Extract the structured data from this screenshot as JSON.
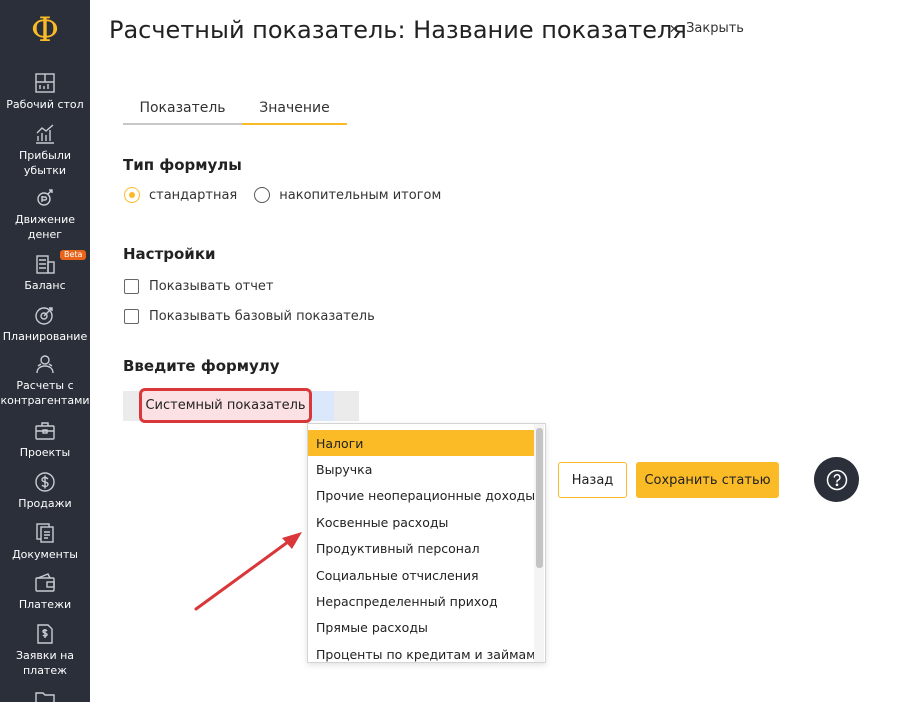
{
  "app": {
    "logo": "Ф",
    "title": "Расчетный показатель: Название показателя",
    "close_label": "Закрыть"
  },
  "sidebar": {
    "items": [
      {
        "label": "Рабочий стол",
        "icon": "desktop-icon"
      },
      {
        "label": "Прибыли\nубытки",
        "icon": "chart-icon"
      },
      {
        "label": "Движение\nденег",
        "icon": "money-flow-icon"
      },
      {
        "label": "Баланс",
        "icon": "balance-icon",
        "badge": "Beta"
      },
      {
        "label": "Планирование",
        "icon": "target-icon"
      },
      {
        "label": "Расчеты с\nконтрагентами",
        "icon": "people-icon"
      },
      {
        "label": "Проекты",
        "icon": "briefcase-icon"
      },
      {
        "label": "Продажи",
        "icon": "dollar-icon"
      },
      {
        "label": "Документы",
        "icon": "documents-icon"
      },
      {
        "label": "Платежи",
        "icon": "wallet-icon"
      },
      {
        "label": "Заявки на\nплатеж",
        "icon": "payment-request-icon"
      }
    ]
  },
  "tabs": [
    {
      "label": "Показатель",
      "active": false
    },
    {
      "label": "Значение",
      "active": true
    }
  ],
  "formula_type": {
    "heading": "Тип формулы",
    "options": [
      {
        "label": "стандартная",
        "selected": true
      },
      {
        "label": "накопительным итогом",
        "selected": false
      }
    ]
  },
  "settings": {
    "heading": "Настройки",
    "checkboxes": [
      {
        "label": "Показывать отчет",
        "checked": false
      },
      {
        "label": "Показывать базовый показатель",
        "checked": false
      }
    ]
  },
  "formula": {
    "heading": "Введите формулу",
    "system_button": "Системный показатель"
  },
  "dropdown": {
    "items": [
      "Налоги",
      "Выручка",
      "Прочие неоперационные доходы",
      "Косвенные расходы",
      "Продуктивный персонал",
      "Социальные отчисления",
      "Нераспределенный приход",
      "Прямые расходы",
      "Проценты по кредитам и займам"
    ],
    "highlighted_index": 0
  },
  "actions": {
    "back": "Назад",
    "save": "Сохранить статью"
  },
  "colors": {
    "accent": "#fbbb27",
    "sidebar": "#2a2f3a",
    "annotation": "#d9373a"
  }
}
